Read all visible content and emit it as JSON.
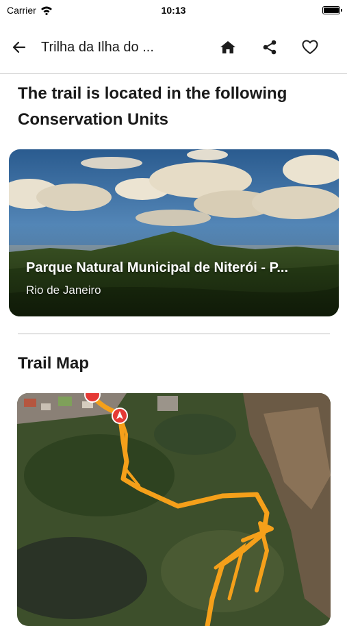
{
  "status_bar": {
    "carrier": "Carrier",
    "time": "10:13"
  },
  "nav": {
    "title": "Trilha da Ilha do ..."
  },
  "sections": {
    "conservation_heading": "The trail is located in the following Conservation Units",
    "map_heading": "Trail Map"
  },
  "conservation_unit": {
    "name": "Parque Natural Municipal de Niterói - P...",
    "region": "Rio de Janeiro"
  },
  "colors": {
    "trail": "#f5a01a",
    "marker": "#e53935"
  }
}
